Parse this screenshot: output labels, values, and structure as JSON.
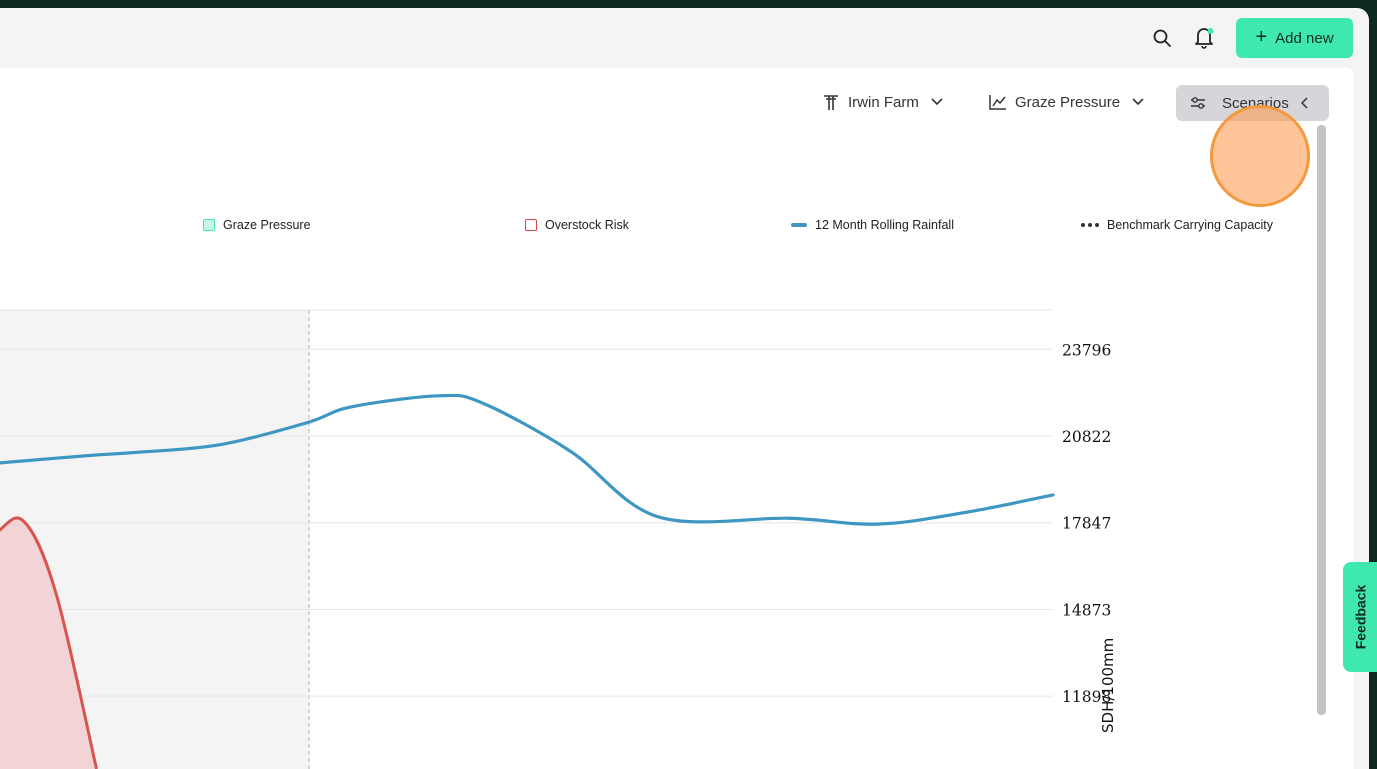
{
  "header": {
    "add_new_label": "Add new",
    "icons": [
      "search-icon",
      "bell-icon"
    ],
    "notification_dot_color": "#3ee8b0"
  },
  "toolbar": {
    "farm_label": "Irwin Farm",
    "metric_label": "Graze Pressure",
    "scenarios_label": "Scenarios"
  },
  "legend": [
    {
      "label": "Graze Pressure",
      "color": "#3ee8b0",
      "marker": "box"
    },
    {
      "label": "Overstock Risk",
      "color": "#d04545",
      "marker": "box"
    },
    {
      "label": "12 Month Rolling Rainfall",
      "color": "#3d97c2",
      "marker": "line"
    },
    {
      "label": "Benchmark Carrying Capacity",
      "color": "#333333",
      "marker": "dots"
    }
  ],
  "feedback_label": "Feedback",
  "colors": {
    "accent": "#3ee8b0",
    "rainfall_line": "#3d97c2",
    "overstock_line": "#d9534f",
    "overstock_fill": "#f2d4d6",
    "shaded_region": "#f4f4f5"
  },
  "chart_data": {
    "type": "line",
    "y_axis_right": {
      "label": "SDH/100mm",
      "ticks": [
        11898,
        14873,
        17847,
        20822,
        23796
      ]
    },
    "grid": true,
    "legend_position": "top",
    "series": [
      {
        "name": "12 Month Rolling Rainfall",
        "points": [
          [
            0,
            19900
          ],
          [
            2,
            20150
          ],
          [
            3,
            20250
          ],
          [
            5,
            20520
          ],
          [
            7,
            21280
          ],
          [
            8,
            21820
          ],
          [
            10,
            22200
          ],
          [
            11,
            21950
          ],
          [
            13,
            20300
          ],
          [
            15,
            18050
          ],
          [
            18,
            18000
          ],
          [
            20,
            17800
          ],
          [
            22,
            18200
          ],
          [
            24,
            18800
          ]
        ]
      },
      {
        "name": "Overstock Risk",
        "points": [
          [
            -2,
            9800
          ],
          [
            -1.2,
            15300
          ],
          [
            0,
            17600
          ],
          [
            0.6,
            17800
          ],
          [
            1.3,
            15300
          ],
          [
            2.2,
            9400
          ]
        ]
      }
    ],
    "x_range": [
      0,
      24
    ],
    "y_range": [
      9400,
      25144
    ]
  }
}
